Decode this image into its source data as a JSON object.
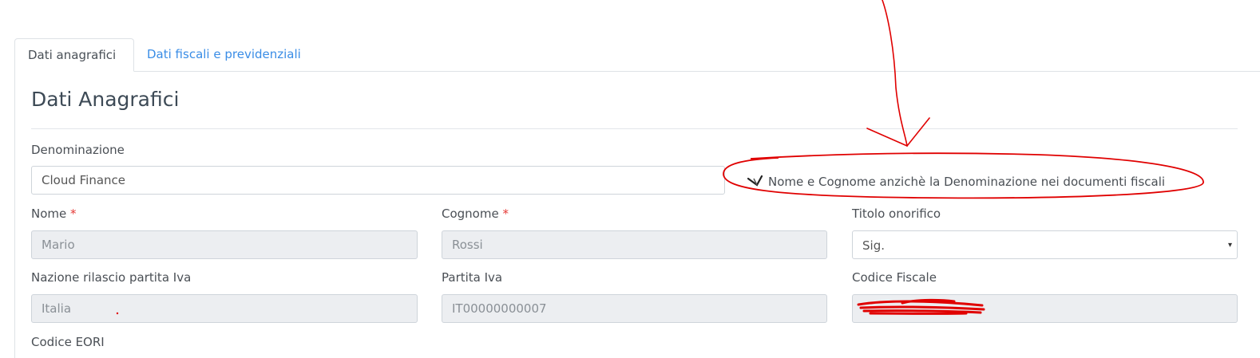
{
  "tabs": [
    {
      "label": "Dati anagrafici",
      "active": true
    },
    {
      "label": "Dati fiscali e previdenziali",
      "active": false
    }
  ],
  "section": {
    "title": "Dati Anagrafici"
  },
  "fields": {
    "denominazione": {
      "label": "Denominazione",
      "value": "Cloud Finance"
    },
    "nome": {
      "label": "Nome",
      "required_mark": "*",
      "value": "Mario"
    },
    "cognome": {
      "label": "Cognome",
      "required_mark": "*",
      "value": "Rossi"
    },
    "titolo": {
      "label": "Titolo onorifico",
      "value": "Sig."
    },
    "nazione": {
      "label": "Nazione rilascio partita Iva",
      "value": "Italia"
    },
    "partita_iva": {
      "label": "Partita Iva",
      "value": "IT00000000007"
    },
    "codice_fiscale": {
      "label": "Codice Fiscale",
      "value": ""
    },
    "codice_eori": {
      "label": "Codice EORI"
    }
  },
  "checkbox": {
    "label": "Nome e Cognome anzichè la Denominazione nei documenti fiscali",
    "checked": true
  },
  "colors": {
    "accent": "#3a8de6",
    "annotation": "#e00000",
    "required": "#e53935"
  },
  "icons": {
    "select_caret": "▾"
  }
}
